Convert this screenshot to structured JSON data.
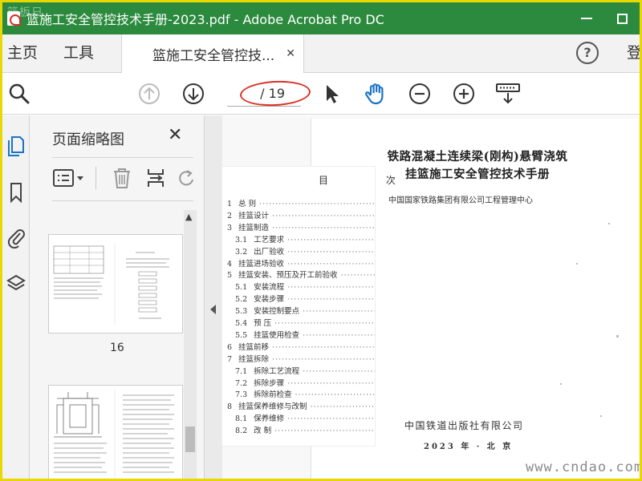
{
  "window": {
    "title": "篮施工安全管控技术手册-2023.pdf - Adobe Acrobat Pro DC",
    "watermark_topleft": "篮板日"
  },
  "tabs": {
    "home": "主页",
    "tools": "工具",
    "document": "篮施工安全管控技...",
    "signin": "登"
  },
  "toolbar": {
    "page_current": "",
    "page_total": "/ 19"
  },
  "thumbnails": {
    "panel_title": "页面缩略图",
    "pages": [
      {
        "number": "16"
      }
    ]
  },
  "document": {
    "cover": {
      "title_line1": "铁路混凝土连续梁(刚构)悬臂浇筑",
      "title_line2": "挂篮施工安全管控技术手册",
      "org": "中国国家铁路集团有限公司工程管理中心",
      "publisher": "中国铁道出版社有限公司",
      "date": "2023 年 · 北 京"
    },
    "toc": {
      "heading": "目 次",
      "entries": [
        {
          "num": "1",
          "text": "总    则"
        },
        {
          "num": "2",
          "text": "挂篮设计"
        },
        {
          "num": "3",
          "text": "挂篮制造"
        },
        {
          "num": "3.1",
          "text": "工艺要求"
        },
        {
          "num": "3.2",
          "text": "出厂验收"
        },
        {
          "num": "4",
          "text": "挂篮进场验收"
        },
        {
          "num": "5",
          "text": "挂篮安装、预压及开工前验收"
        },
        {
          "num": "5.1",
          "text": "安装流程"
        },
        {
          "num": "5.2",
          "text": "安装步骤"
        },
        {
          "num": "5.3",
          "text": "安装控制要点"
        },
        {
          "num": "5.4",
          "text": "预    压"
        },
        {
          "num": "5.5",
          "text": "挂篮使用检查"
        },
        {
          "num": "6",
          "text": "挂篮前移"
        },
        {
          "num": "7",
          "text": "挂篮拆除"
        },
        {
          "num": "7.1",
          "text": "拆除工艺流程"
        },
        {
          "num": "7.2",
          "text": "拆除步骤"
        },
        {
          "num": "7.3",
          "text": "拆除前检查"
        },
        {
          "num": "8",
          "text": "挂篮保养维修与改制"
        },
        {
          "num": "8.1",
          "text": "保养维修"
        },
        {
          "num": "8.2",
          "text": "改    制"
        }
      ]
    }
  },
  "site_watermark": "www.cndao.com",
  "colors": {
    "titlebar": "#2b8a3e",
    "frame_border": "#e8d800",
    "annotation_oval": "#d93025",
    "icon_blue": "#1a73c8"
  }
}
